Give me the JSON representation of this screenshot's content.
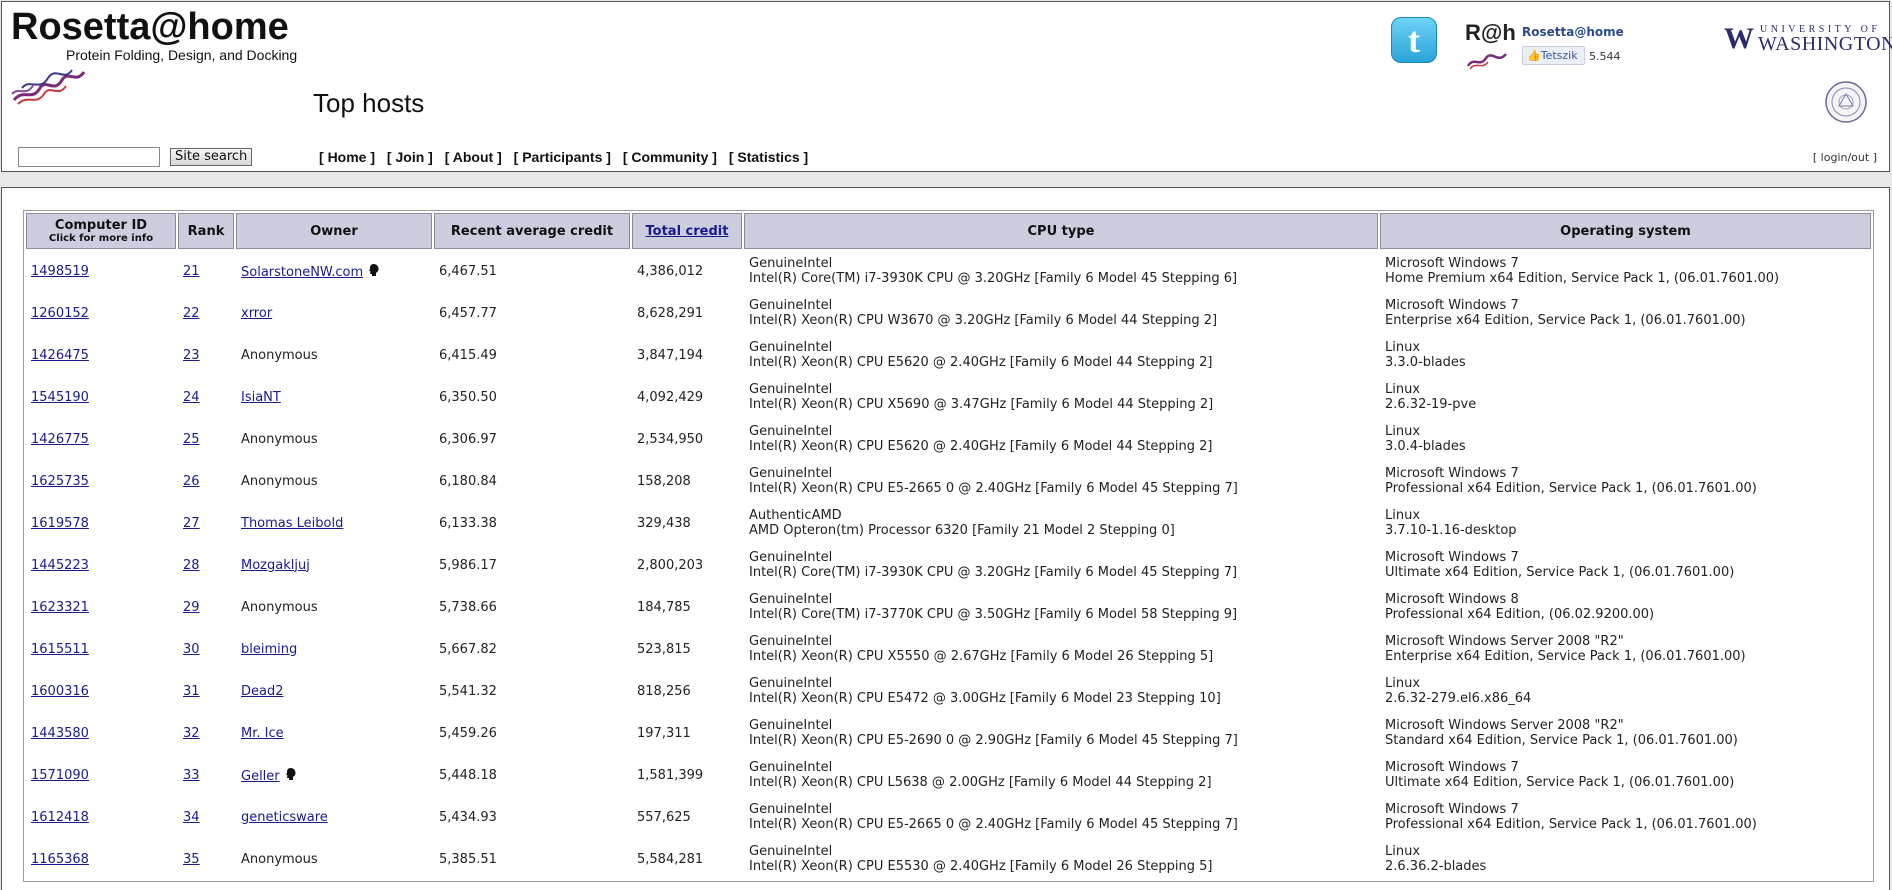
{
  "header": {
    "logo_title": "Rosetta@home",
    "logo_subtitle": "Protein Folding, Design, and Docking",
    "page_title": "Top hosts",
    "search_button": "Site search",
    "search_value": "",
    "nav": [
      {
        "label": "Home"
      },
      {
        "label": "Join"
      },
      {
        "label": "About"
      },
      {
        "label": "Participants"
      },
      {
        "label": "Community"
      },
      {
        "label": "Statistics"
      }
    ],
    "login_label": "login/out",
    "twitter_glyph": "t",
    "rah_logo": "R@h",
    "rah_name": "Rosetta@home",
    "like_label": "Tetszik",
    "like_count": "5.544",
    "uw_university": "UNIVERSITY OF",
    "uw_washington": "WASHINGTON",
    "uw_w_glyph": "W"
  },
  "table": {
    "headers": {
      "computer_id": "Computer ID",
      "computer_id_sub": "Click for more info",
      "rank": "Rank",
      "owner": "Owner",
      "recent_avg": "Recent average credit",
      "total_credit": "Total credit",
      "cpu": "CPU type",
      "os": "Operating system"
    },
    "rows": [
      {
        "id": "1498519",
        "rank": "21",
        "owner": "SolarstoneNW.com",
        "owner_link": true,
        "pm": true,
        "rac": "6,467.51",
        "total": "4,386,012",
        "cpu1": "GenuineIntel",
        "cpu2": "Intel(R) Core(TM) i7-3930K CPU @ 3.20GHz [Family 6 Model 45 Stepping 6]",
        "os1": "Microsoft Windows 7",
        "os2": "Home Premium x64 Edition, Service Pack 1, (06.01.7601.00)"
      },
      {
        "id": "1260152",
        "rank": "22",
        "owner": "xrror",
        "owner_link": true,
        "pm": false,
        "rac": "6,457.77",
        "total": "8,628,291",
        "cpu1": "GenuineIntel",
        "cpu2": "Intel(R) Xeon(R) CPU W3670 @ 3.20GHz [Family 6 Model 44 Stepping 2]",
        "os1": "Microsoft Windows 7",
        "os2": "Enterprise x64 Edition, Service Pack 1, (06.01.7601.00)"
      },
      {
        "id": "1426475",
        "rank": "23",
        "owner": "Anonymous",
        "owner_link": false,
        "pm": false,
        "rac": "6,415.49",
        "total": "3,847,194",
        "cpu1": "GenuineIntel",
        "cpu2": "Intel(R) Xeon(R) CPU E5620 @ 2.40GHz [Family 6 Model 44 Stepping 2]",
        "os1": "Linux",
        "os2": "3.3.0-blades"
      },
      {
        "id": "1545190",
        "rank": "24",
        "owner": "IsiaNT",
        "owner_link": true,
        "pm": false,
        "rac": "6,350.50",
        "total": "4,092,429",
        "cpu1": "GenuineIntel",
        "cpu2": "Intel(R) Xeon(R) CPU X5690 @ 3.47GHz [Family 6 Model 44 Stepping 2]",
        "os1": "Linux",
        "os2": "2.6.32-19-pve"
      },
      {
        "id": "1426775",
        "rank": "25",
        "owner": "Anonymous",
        "owner_link": false,
        "pm": false,
        "rac": "6,306.97",
        "total": "2,534,950",
        "cpu1": "GenuineIntel",
        "cpu2": "Intel(R) Xeon(R) CPU E5620 @ 2.40GHz [Family 6 Model 44 Stepping 2]",
        "os1": "Linux",
        "os2": "3.0.4-blades"
      },
      {
        "id": "1625735",
        "rank": "26",
        "owner": "Anonymous",
        "owner_link": false,
        "pm": false,
        "rac": "6,180.84",
        "total": "158,208",
        "cpu1": "GenuineIntel",
        "cpu2": "Intel(R) Xeon(R) CPU E5-2665 0 @ 2.40GHz [Family 6 Model 45 Stepping 7]",
        "os1": "Microsoft Windows 7",
        "os2": "Professional x64 Edition, Service Pack 1, (06.01.7601.00)"
      },
      {
        "id": "1619578",
        "rank": "27",
        "owner": "Thomas Leibold",
        "owner_link": true,
        "pm": false,
        "rac": "6,133.38",
        "total": "329,438",
        "cpu1": "AuthenticAMD",
        "cpu2": "AMD Opteron(tm) Processor 6320 [Family 21 Model 2 Stepping 0]",
        "os1": "Linux",
        "os2": "3.7.10-1.16-desktop"
      },
      {
        "id": "1445223",
        "rank": "28",
        "owner": "Mozgakljuj",
        "owner_link": true,
        "pm": false,
        "rac": "5,986.17",
        "total": "2,800,203",
        "cpu1": "GenuineIntel",
        "cpu2": "Intel(R) Core(TM) i7-3930K CPU @ 3.20GHz [Family 6 Model 45 Stepping 7]",
        "os1": "Microsoft Windows 7",
        "os2": "Ultimate x64 Edition, Service Pack 1, (06.01.7601.00)"
      },
      {
        "id": "1623321",
        "rank": "29",
        "owner": "Anonymous",
        "owner_link": false,
        "pm": false,
        "rac": "5,738.66",
        "total": "184,785",
        "cpu1": "GenuineIntel",
        "cpu2": "Intel(R) Core(TM) i7-3770K CPU @ 3.50GHz [Family 6 Model 58 Stepping 9]",
        "os1": "Microsoft Windows 8",
        "os2": "Professional x64 Edition, (06.02.9200.00)"
      },
      {
        "id": "1615511",
        "rank": "30",
        "owner": "bleiming",
        "owner_link": true,
        "pm": false,
        "rac": "5,667.82",
        "total": "523,815",
        "cpu1": "GenuineIntel",
        "cpu2": "Intel(R) Xeon(R) CPU X5550 @ 2.67GHz [Family 6 Model 26 Stepping 5]",
        "os1": "Microsoft Windows Server 2008 \"R2\"",
        "os2": "Enterprise x64 Edition, Service Pack 1, (06.01.7601.00)"
      },
      {
        "id": "1600316",
        "rank": "31",
        "owner": "Dead2",
        "owner_link": true,
        "pm": false,
        "rac": "5,541.32",
        "total": "818,256",
        "cpu1": "GenuineIntel",
        "cpu2": "Intel(R) Xeon(R) CPU E5472 @ 3.00GHz [Family 6 Model 23 Stepping 10]",
        "os1": "Linux",
        "os2": "2.6.32-279.el6.x86_64"
      },
      {
        "id": "1443580",
        "rank": "32",
        "owner": "Mr. Ice",
        "owner_link": true,
        "pm": false,
        "rac": "5,459.26",
        "total": "197,311",
        "cpu1": "GenuineIntel",
        "cpu2": "Intel(R) Xeon(R) CPU E5-2690 0 @ 2.90GHz [Family 6 Model 45 Stepping 7]",
        "os1": "Microsoft Windows Server 2008 \"R2\"",
        "os2": "Standard x64 Edition, Service Pack 1, (06.01.7601.00)"
      },
      {
        "id": "1571090",
        "rank": "33",
        "owner": "Geller",
        "owner_link": true,
        "pm": true,
        "rac": "5,448.18",
        "total": "1,581,399",
        "cpu1": "GenuineIntel",
        "cpu2": "Intel(R) Xeon(R) CPU L5638 @ 2.00GHz [Family 6 Model 44 Stepping 2]",
        "os1": "Microsoft Windows 7",
        "os2": "Ultimate x64 Edition, Service Pack 1, (06.01.7601.00)"
      },
      {
        "id": "1612418",
        "rank": "34",
        "owner": "geneticsware",
        "owner_link": true,
        "pm": false,
        "rac": "5,434.93",
        "total": "557,625",
        "cpu1": "GenuineIntel",
        "cpu2": "Intel(R) Xeon(R) CPU E5-2665 0 @ 2.40GHz [Family 6 Model 45 Stepping 7]",
        "os1": "Microsoft Windows 7",
        "os2": "Professional x64 Edition, Service Pack 1, (06.01.7601.00)"
      },
      {
        "id": "1165368",
        "rank": "35",
        "owner": "Anonymous",
        "owner_link": false,
        "pm": false,
        "rac": "5,385.51",
        "total": "5,584,281",
        "cpu1": "GenuineIntel",
        "cpu2": "Intel(R) Xeon(R) CPU E5530 @ 2.40GHz [Family 6 Model 26 Stepping 5]",
        "os1": "Linux",
        "os2": "2.6.36.2-blades"
      }
    ]
  },
  "colors": {
    "header_bg": "#cdcde0",
    "link": "#1a1a8c",
    "page_bg": "#e8e8e8"
  },
  "icons": {
    "profile_icon": "person-silhouette-icon",
    "twitter_icon": "twitter-bird-icon",
    "seal_icon": "university-seal-icon"
  }
}
